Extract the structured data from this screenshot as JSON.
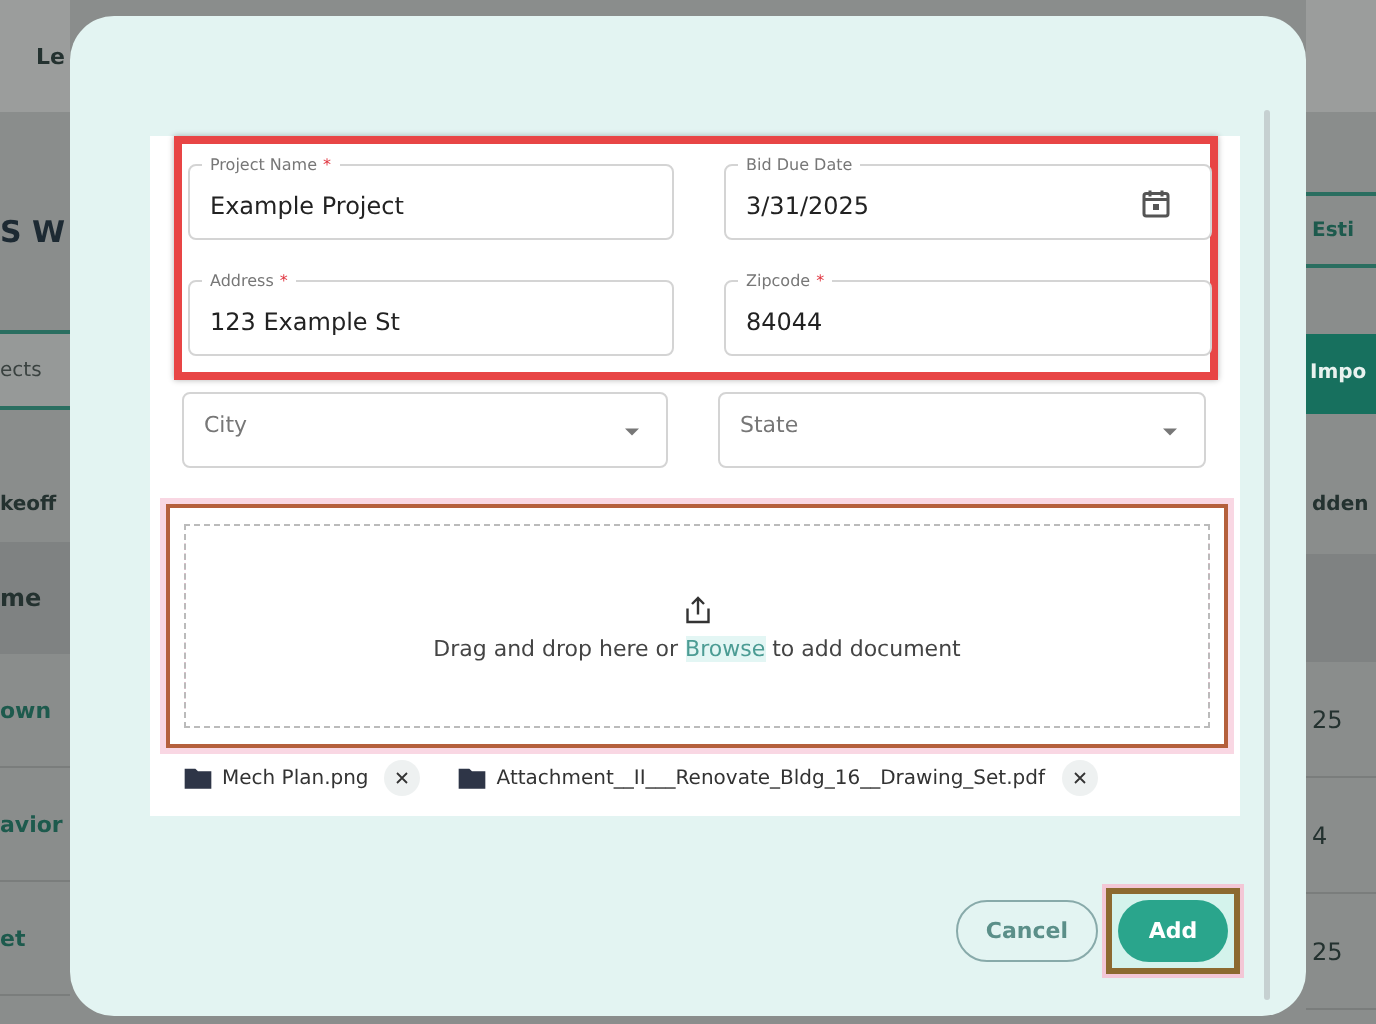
{
  "background": {
    "left": [
      {
        "kind": "nav",
        "text": "Le"
      },
      {
        "kind": "heading",
        "text": "S W"
      },
      {
        "kind": "tab",
        "text": "ects"
      },
      {
        "kind": "section",
        "text": "keoff"
      },
      {
        "kind": "header",
        "text": "me"
      },
      {
        "kind": "link",
        "text": "own"
      },
      {
        "kind": "link",
        "text": "avior"
      },
      {
        "kind": "link",
        "text": "et"
      }
    ],
    "right": [
      {
        "kind": "nav"
      },
      {
        "kind": "outline",
        "text": "Esti"
      },
      {
        "kind": "filled",
        "text": "Impo"
      },
      {
        "kind": "section",
        "text": "dden"
      },
      {
        "kind": "header"
      },
      {
        "kind": "cell",
        "text": "25"
      },
      {
        "kind": "cell",
        "text": "4"
      },
      {
        "kind": "cell",
        "text": "25"
      }
    ]
  },
  "dialog": {
    "fields": [
      {
        "kind": "text",
        "label": "Project Name",
        "marker": "*",
        "value": "Example Project"
      },
      {
        "kind": "date",
        "label": "Bid Due Date",
        "value": "3/31/2025"
      },
      {
        "kind": "text",
        "label": "Address",
        "marker": "*",
        "value": "123 Example St"
      },
      {
        "kind": "text",
        "label": "Zipcode",
        "marker": "*",
        "value": "84044"
      },
      {
        "kind": "select",
        "placeholder": "City"
      },
      {
        "kind": "select",
        "placeholder": "State"
      }
    ],
    "fields_highlighted": true,
    "dropzone": {
      "highlighted": true,
      "text_before": "Drag and drop here or",
      "link": "Browse",
      "text_after": "to add document"
    },
    "files": [
      {
        "name": "Mech Plan.png"
      },
      {
        "name": "Attachment__II___Renovate_Bldg_16__Drawing_Set.pdf"
      }
    ],
    "buttons": [
      {
        "kind": "outline",
        "label": "Cancel",
        "highlighted": false
      },
      {
        "kind": "primary",
        "label": "Add",
        "highlighted": true
      }
    ]
  }
}
